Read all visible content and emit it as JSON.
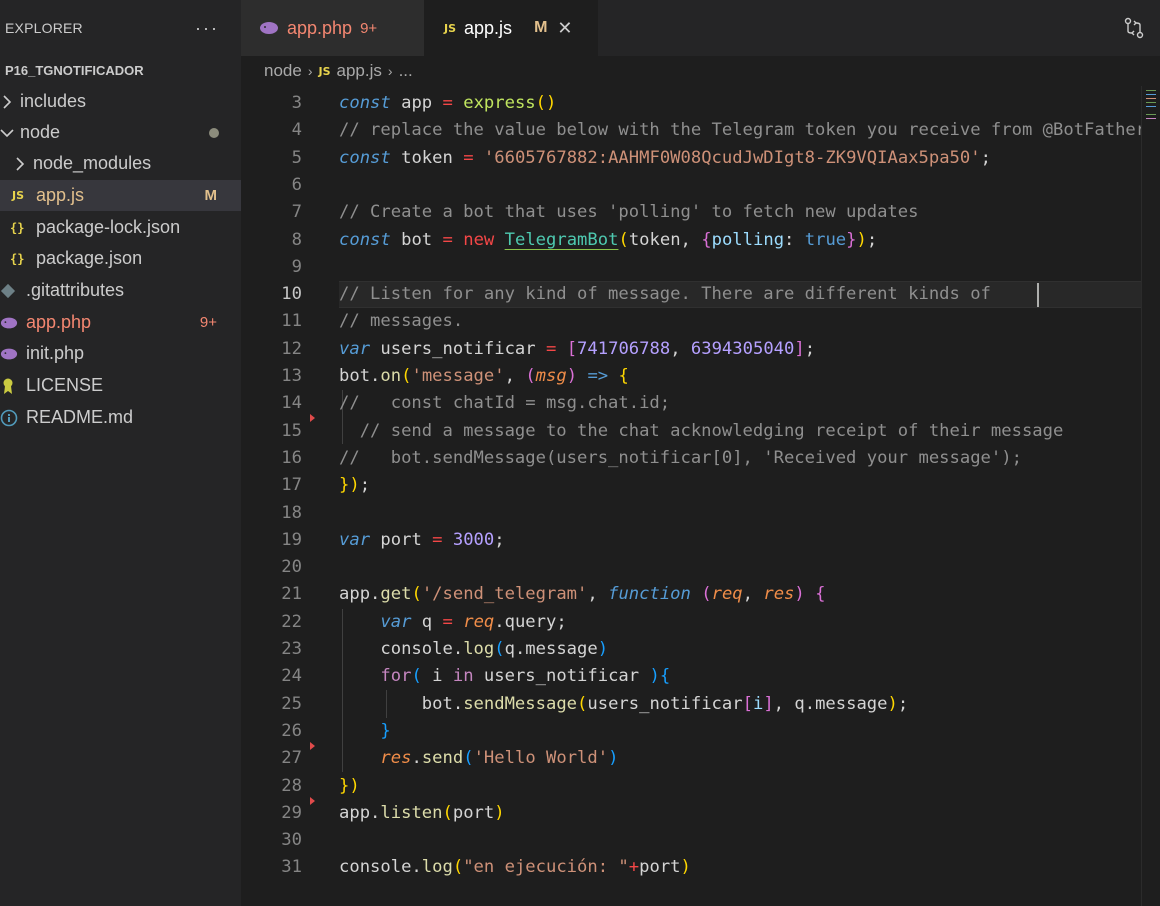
{
  "sidebar": {
    "title": "EXPLORER",
    "more": "···",
    "project": "P16_TGNOTIFICADOR",
    "items": [
      {
        "label": "includes",
        "badge": ""
      },
      {
        "label": "node",
        "badge": ""
      },
      {
        "label": "node_modules",
        "badge": ""
      },
      {
        "label": "app.js",
        "badge": "M"
      },
      {
        "label": "package-lock.json",
        "badge": ""
      },
      {
        "label": "package.json",
        "badge": ""
      },
      {
        "label": ".gitattributes",
        "badge": ""
      },
      {
        "label": "app.php",
        "badge": "9+"
      },
      {
        "label": "init.php",
        "badge": ""
      },
      {
        "label": "LICENSE",
        "badge": ""
      },
      {
        "label": "README.md",
        "badge": ""
      }
    ]
  },
  "tabs": [
    {
      "label": "app.php",
      "badge": "9+"
    },
    {
      "label": "app.js",
      "badge": "M",
      "close": "✕"
    }
  ],
  "breadcrumb": {
    "folder": "node",
    "file": "app.js",
    "more": "..."
  },
  "editor": {
    "current_line": 10,
    "lines": [
      {
        "n": 3
      },
      {
        "n": 4
      },
      {
        "n": 5
      },
      {
        "n": 6
      },
      {
        "n": 7
      },
      {
        "n": 8
      },
      {
        "n": 9
      },
      {
        "n": 10
      },
      {
        "n": 11
      },
      {
        "n": 12
      },
      {
        "n": 13
      },
      {
        "n": 14
      },
      {
        "n": 15
      },
      {
        "n": 16
      },
      {
        "n": 17
      },
      {
        "n": 18
      },
      {
        "n": 19
      },
      {
        "n": 20
      },
      {
        "n": 21
      },
      {
        "n": 22
      },
      {
        "n": 23
      },
      {
        "n": 24
      },
      {
        "n": 25
      },
      {
        "n": 26
      },
      {
        "n": 27
      },
      {
        "n": 28
      },
      {
        "n": 29
      },
      {
        "n": 30
      },
      {
        "n": 31
      }
    ],
    "code": {
      "l3": [
        "const",
        " app ",
        "=",
        " ",
        "express",
        "()"
      ],
      "l4": "// replace the value below with the Telegram token you receive from @BotFather",
      "l5": [
        "const",
        " token ",
        "=",
        " ",
        "'6605767882:AAHMF0W08QcudJwDIgt8-ZK9VQIAax5pa50'",
        ";"
      ],
      "l7": "// Create a bot that uses 'polling' to fetch new updates",
      "l8": [
        "const",
        " bot ",
        "=",
        " ",
        "new",
        " ",
        "TelegramBot",
        "(",
        "token, ",
        "{",
        "polling",
        ": ",
        "true",
        "}",
        ")",
        ";"
      ],
      "l10": "// Listen for any kind of message. There are different kinds of",
      "l11": "// messages.",
      "l12": [
        "var",
        " users_notificar ",
        "=",
        " ",
        "[",
        "741706788",
        ", ",
        "6394305040",
        "]",
        ";"
      ],
      "l13": [
        "bot",
        ".",
        "on",
        "(",
        "'message'",
        ", ",
        "(",
        "msg",
        ")",
        " ",
        "=>",
        " ",
        "{"
      ],
      "l14": "//   const chatId = msg.chat.id;",
      "l15": "  // send a message to the chat acknowledging receipt of their message",
      "l16": "//   bot.sendMessage(users_notificar[0], 'Received your message');",
      "l17": [
        "}",
        ")",
        ";"
      ],
      "l19": [
        "var",
        " port ",
        "=",
        " ",
        "3000",
        ";"
      ],
      "l21": [
        "app",
        ".",
        "get",
        "(",
        "'/send_telegram'",
        ", ",
        "function",
        " ",
        "(",
        "req",
        ", ",
        "res",
        ")",
        " ",
        "{"
      ],
      "l22": [
        "    ",
        "var",
        " q ",
        "=",
        " ",
        "req",
        ".query;"
      ],
      "l23": [
        "    console.",
        "log",
        "(",
        "q.message",
        ")"
      ],
      "l24": [
        "    ",
        "for",
        "(",
        " i ",
        "in",
        " users_notificar ",
        ")",
        "{"
      ],
      "l25": [
        "        bot.",
        "sendMessage",
        "(",
        "users_notificar",
        "[",
        "i",
        "]",
        ", q.message",
        ")",
        ";"
      ],
      "l26": [
        "    ",
        "}"
      ],
      "l27": [
        "    ",
        "res",
        ".",
        "send",
        "(",
        "'Hello World'",
        ")"
      ],
      "l28": [
        "}",
        ")"
      ],
      "l29": [
        "app.",
        "listen",
        "(",
        "port",
        ")"
      ],
      "l31": [
        "console.",
        "log",
        "(",
        "\"en ejecución: \"",
        "+",
        "port",
        ")"
      ]
    }
  }
}
